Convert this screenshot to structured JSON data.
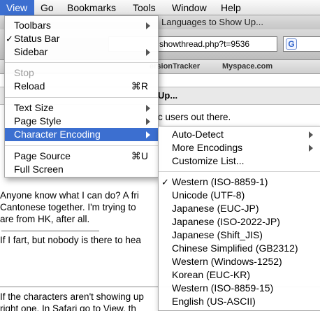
{
  "menubar": {
    "apple": "",
    "items": [
      "View",
      "Go",
      "Bookmarks",
      "Tools",
      "Window",
      "Help"
    ]
  },
  "browser": {
    "tab_title": "Languages to Show Up...",
    "url": "showthread.php?t=9536",
    "search_engine": "G",
    "bookmarks": [
      "ersionTracker",
      "Myspace.com"
    ],
    "post_title": "Up...",
    "lines": [
      "c users out there.",
      "Anyone know what I can do? A fri",
      "Cantonese together. I'm trying to",
      "are from HK, after all.",
      "If I fart, but nobody is there to hea",
      "If the characters aren't showing up",
      "right one. In Safari go to View, th"
    ]
  },
  "view_menu": {
    "toolbars": "Toolbars",
    "status_bar": "Status Bar",
    "sidebar": "Sidebar",
    "stop": "Stop",
    "reload": "Reload",
    "reload_shortcut": "⌘R",
    "text_size": "Text Size",
    "page_style": "Page Style",
    "character_encoding": "Character Encoding",
    "page_source": "Page Source",
    "page_source_shortcut": "⌘U",
    "full_screen": "Full Screen",
    "checkmark": "✓"
  },
  "encoding_menu": {
    "auto_detect": "Auto-Detect",
    "more_encodings": "More Encodings",
    "customize_list": "Customize List...",
    "checkmark": "✓",
    "encodings": [
      "Western (ISO-8859-1)",
      "Unicode (UTF-8)",
      "Japanese (EUC-JP)",
      "Japanese (ISO-2022-JP)",
      "Japanese (Shift_JIS)",
      "Chinese Simplified (GB2312)",
      "Western (Windows-1252)",
      "Korean (EUC-KR)",
      "Western (ISO-8859-15)",
      "English (US-ASCII)"
    ]
  },
  "colors": {
    "highlight": "#3c6fd0",
    "disabled_text": "#9b9b9b"
  }
}
